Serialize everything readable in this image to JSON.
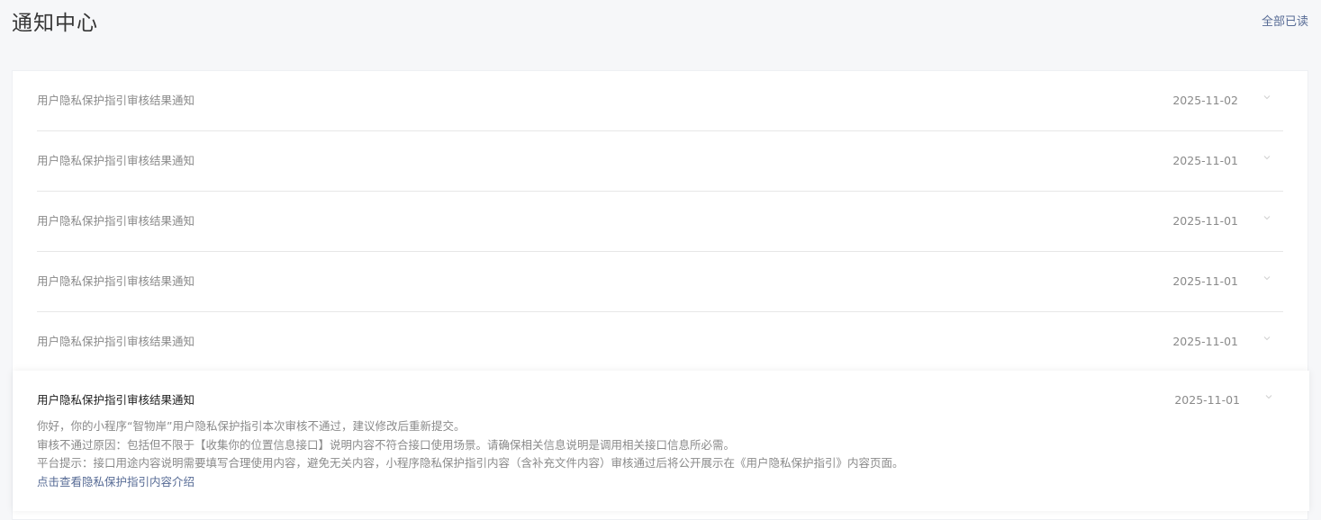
{
  "header": {
    "title": "通知中心",
    "mark_all_read": "全部已读"
  },
  "notifications": [
    {
      "title": "用户隐私保护指引审核结果通知",
      "date": "2025-11-02"
    },
    {
      "title": "用户隐私保护指引审核结果通知",
      "date": "2025-11-01"
    },
    {
      "title": "用户隐私保护指引审核结果通知",
      "date": "2025-11-01"
    },
    {
      "title": "用户隐私保护指引审核结果通知",
      "date": "2025-11-01"
    },
    {
      "title": "用户隐私保护指引审核结果通知",
      "date": "2025-11-01"
    }
  ],
  "expanded": {
    "title": "用户隐私保护指引审核结果通知",
    "date": "2025-11-01",
    "lines": [
      "你好，你的小程序“智物岸”用户隐私保护指引本次审核不通过，建议修改后重新提交。",
      "审核不通过原因：包括但不限于【收集你的位置信息接口】说明内容不符合接口使用场景。请确保相关信息说明是调用相关接口信息所必需。",
      "平台提示：接口用途内容说明需要填写合理使用内容，避免无关内容，小程序隐私保护指引内容（含补充文件内容）审核通过后将公开展示在《用户隐私保护指引》内容页面。"
    ],
    "link": "点击查看隐私保护指引内容介绍"
  },
  "colors": {
    "link": "#576b95",
    "muted_text": "#8a8a8a",
    "dark_text": "#1e1e1e",
    "background": "#f6f7f9"
  },
  "icons": {
    "row_toggle": "chevron-down-icon"
  }
}
